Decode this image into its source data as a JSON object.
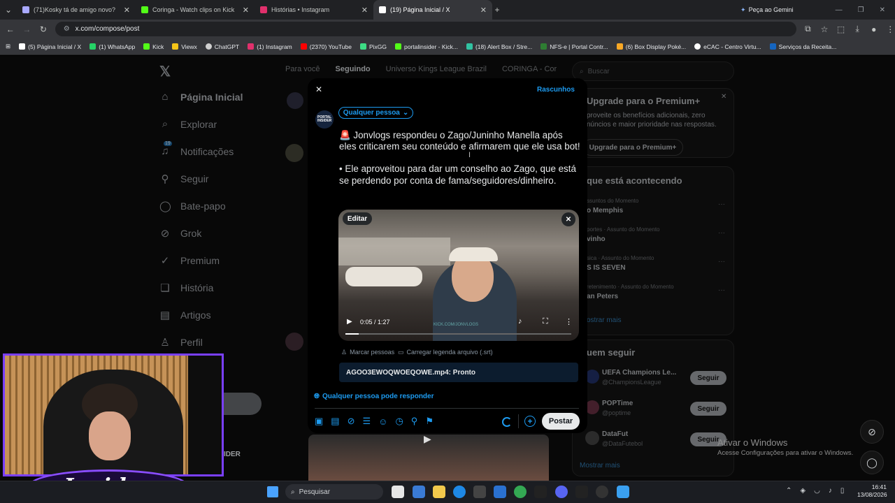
{
  "browser": {
    "tabs": [
      {
        "title": "(71)Kosky tá de amigo novo?",
        "color": "#a9a9ff"
      },
      {
        "title": "Coringa - Watch clips on Kick",
        "color": "#53fc18"
      },
      {
        "title": "Histórias • Instagram",
        "color": "#e1306c"
      },
      {
        "title": "(19) Página Inicial / X",
        "color": "#ffffff"
      }
    ],
    "gemini_label": "Peça ao Gemini",
    "url": "x.com/compose/post",
    "bookmarks": [
      "(5) Página Inicial / X",
      "(1) WhatsApp",
      "Kick",
      "Viewx",
      "ChatGPT",
      "(1) Instagram",
      "(2370) YouTube",
      "PixGG",
      "portalinsider - Kick...",
      "(18) Alert Box / Stre...",
      "NFS-e | Portal Contr...",
      "(6) Box Display Poké...",
      "eCAC - Centro Virtu...",
      "Serviços da Receita..."
    ]
  },
  "x_sidebar": {
    "items": [
      {
        "label": "Página Inicial",
        "icon": "home-icon"
      },
      {
        "label": "Explorar",
        "icon": "search-icon"
      },
      {
        "label": "Notificações",
        "icon": "bell-icon",
        "badge": "19"
      },
      {
        "label": "Seguir",
        "icon": "follow-icon"
      },
      {
        "label": "Bate-papo",
        "icon": "chat-icon"
      },
      {
        "label": "Grok",
        "icon": "grok-icon"
      },
      {
        "label": "Premium",
        "icon": "premium-icon"
      },
      {
        "label": "História",
        "icon": "bookmark-icon"
      },
      {
        "label": "Artigos",
        "icon": "article-icon"
      },
      {
        "label": "Perfil",
        "icon": "profile-icon"
      }
    ]
  },
  "feed_tabs": [
    "Para você",
    "Seguindo",
    "Universo Kings League Brazil",
    "CORINGA - Cor"
  ],
  "right_col": {
    "search_placeholder": "Buscar",
    "premium_title": "Upgrade para o Premium+",
    "premium_text": "proveite os benefícios adicionais, zero núncios e maior prioridade nas respostas.",
    "premium_button": "Upgrade para o Premium+",
    "happening_title": "que está acontecendo",
    "trends": [
      {
        "meta": "ssuntos do Momento",
        "name": "o Memphis"
      },
      {
        "meta": "portes · Assunto do Momento",
        "name": "vinho"
      },
      {
        "meta": "sica · Assunto do Momento",
        "name": "S IS SEVEN"
      },
      {
        "meta": "retenimento · Assunto do Momento",
        "name": "an Peters"
      }
    ],
    "show_more": "ostrar mais",
    "who_follow_title": "uem seguir",
    "follow_suggestions": [
      {
        "name": "UEFA Champions Le...",
        "handle": "@ChampionsLeague",
        "button": "Seguir"
      },
      {
        "name": "POPTime",
        "handle": "@poptime",
        "button": "Seguir"
      },
      {
        "name": "DataFut",
        "handle": "@DataFutebol",
        "button": "Seguir"
      }
    ],
    "show_more_2": "Mostrar mais"
  },
  "compose": {
    "drafts": "Rascunhos",
    "audience": "Qualquer pessoa",
    "avatar_text": "PORTAL INSIDER",
    "line1": "🚨 Jonvlogs respondeu o Zago/Juninho Manella após eles criticarem seu conteúdo e afirmarem que ele usa bot!",
    "line2": "• Ele aproveitou para dar um conselho ao Zago, que está se perdendo por conta de fama/seguidores/dinheiro.",
    "edit": "Editar",
    "video_time": "0:05 / 1:27",
    "video_progress": 0.06,
    "watermark": "KICK.COM/JONVLOGS",
    "tag_people": "Marcar pessoas",
    "upload_caption": "Carregar legenda arquivo (.srt)",
    "upload_status": "AGOO3EWOQWOEQOWE.mp4: Pronto",
    "reply_setting": "Qualquer pessoa pode responder",
    "post_button": "Postar"
  },
  "windows": {
    "activate_title": "Ativar o Windows",
    "activate_text": "Acesse Configurações para ativar o Windows.",
    "search": "Pesquisar",
    "time": "16:41",
    "date": "13/08/2026"
  },
  "overlay": {
    "logo_text": "Insider",
    "partial_name": "IDER"
  }
}
